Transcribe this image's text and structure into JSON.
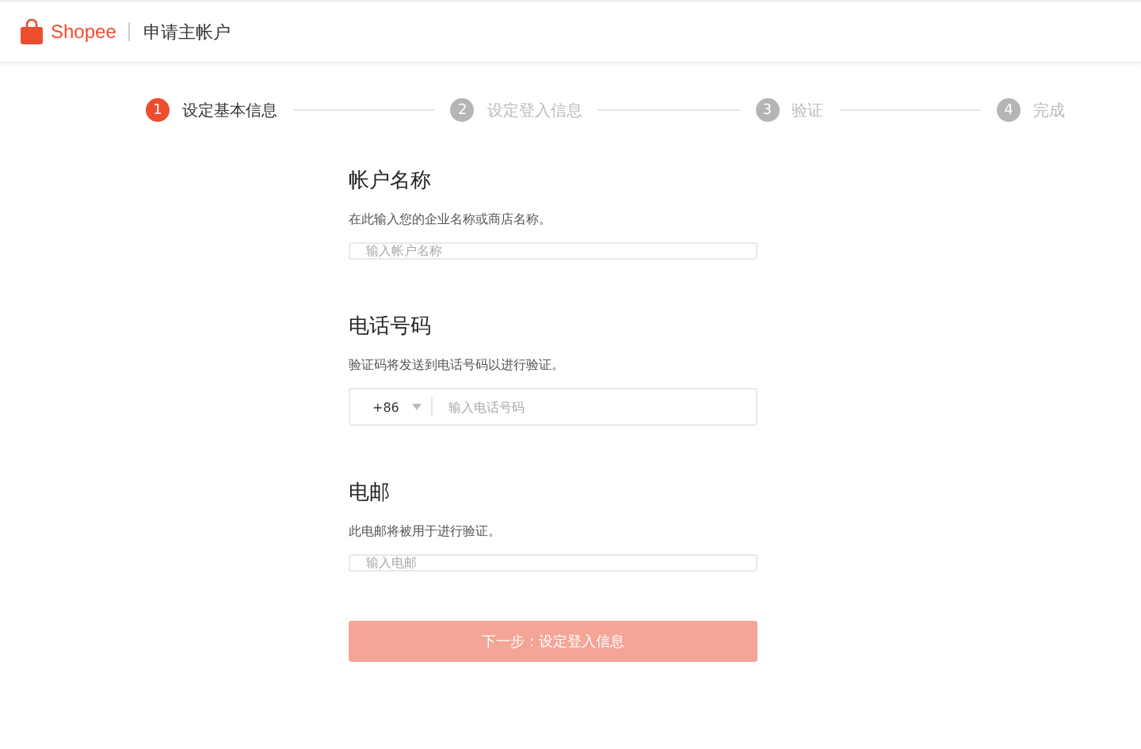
{
  "header": {
    "logo": "Shopee",
    "title": "申请主帐户"
  },
  "steps": [
    {
      "number": "1",
      "label": "设定基本信息",
      "selected": true
    },
    {
      "number": "2",
      "label": "设定登入信息",
      "selected": false
    },
    {
      "number": "3",
      "label": "验证",
      "selected": false
    },
    {
      "number": "4",
      "label": "完成",
      "selected": false
    }
  ],
  "sections": [
    {
      "kind": "text",
      "title": "帐户名称",
      "description": "在此输入您的企业名称或商店名称。",
      "placeholder": "输入帐户名称"
    },
    {
      "kind": "phone",
      "title": "电话号码",
      "description": "验证码将发送到电话号码以进行验证。",
      "country_code": "+86",
      "placeholder": "输入电话号码"
    },
    {
      "kind": "text",
      "title": "电邮",
      "description": "此电邮将被用于进行验证。",
      "placeholder": "输入电邮"
    }
  ],
  "next_button": {
    "label": "下一步：设定登入信息",
    "disabled": true
  }
}
